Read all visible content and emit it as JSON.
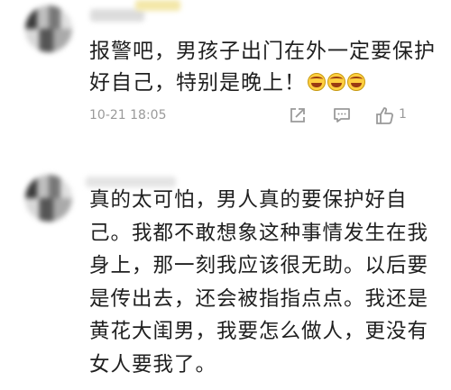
{
  "comments": [
    {
      "text_line1": "报警吧，男孩子出门在外一定要保护",
      "text_line2": "好自己，特别是晚上！",
      "emoji_count": 3,
      "timestamp": "10-21 18:05",
      "like_count": "1"
    },
    {
      "text": "真的太可怕，男人真的要保护好自己。我都不敢想象这种事情发生在我身上，那一刻我应该很无助。以后要是传出去，还会被指指点点。我还是黄花大闺男，我要怎么做人，更没有女人要我了。"
    }
  ],
  "icons": {
    "share": "share-icon",
    "comment": "comment-icon",
    "like": "thumbs-up-icon"
  }
}
